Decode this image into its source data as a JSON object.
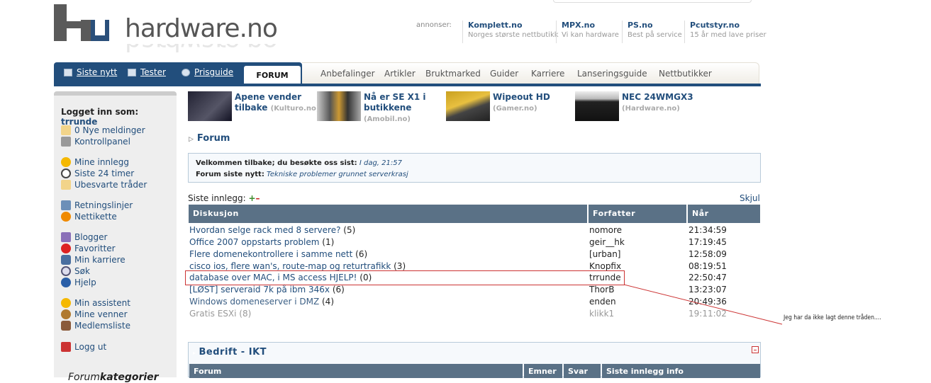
{
  "header": {
    "logo_text": "hardware.no",
    "ads_label": "annonser:",
    "ads": [
      {
        "title": "Komplett.no",
        "sub": "Norges største nettbutikk"
      },
      {
        "title": "MPX.no",
        "sub": "Vi kan hardware"
      },
      {
        "title": "PS.no",
        "sub": "Best på service"
      },
      {
        "title": "Pcutstyr.no",
        "sub": "15 år med lave priser"
      }
    ]
  },
  "nav": {
    "left_tabs": [
      "Siste nytt",
      "Tester",
      "Prisguide"
    ],
    "active_tab": "FORUM",
    "right_tabs": [
      "Anbefalinger",
      "Artikler",
      "Bruktmarked",
      "Guider",
      "Karriere",
      "Lanseringsguide",
      "Nettbutikker"
    ]
  },
  "sidebar": {
    "login_label": "Logget inn som:",
    "username": "trrunde",
    "group1": [
      "0 Nye meldinger",
      "Kontrollpanel"
    ],
    "group2": [
      "Mine innlegg",
      "Siste 24 timer",
      "Ubesvarte tråder"
    ],
    "group3": [
      "Retningslinjer",
      "Nettikette"
    ],
    "group4": [
      "Blogger",
      "Favoritter",
      "Min karriere",
      "Søk",
      "Hjelp"
    ],
    "group5": [
      "Min assistent",
      "Mine venner",
      "Medlemsliste"
    ],
    "group6": [
      "Logg ut"
    ],
    "forumkat_a": "Forum",
    "forumkat_b": "kategorier"
  },
  "news": [
    {
      "title": "Apene vender tilbake",
      "src": "(Kulturo.no)"
    },
    {
      "title": "Nå er SE X1 i butikkene",
      "src": "(Amobil.no)"
    },
    {
      "title": "Wipeout HD",
      "src": "(Gamer.no)"
    },
    {
      "title": "NEC 24WMGX3",
      "src": "(Hardware.no)"
    }
  ],
  "forum": {
    "heading": "Forum",
    "welcome_label": "Velkommen tilbake; du besøkte oss sist:",
    "welcome_value": "I dag, 21:57",
    "news_label": "Forum siste nytt:",
    "news_value": "Tekniske problemer grunnet serverkrasj",
    "recent_label": "Siste innlegg:",
    "hide_label": "Skjul"
  },
  "recent": {
    "columns": [
      "Diskusjon",
      "Forfatter",
      "Når"
    ],
    "rows": [
      {
        "title": "Hvordan selge rack med 8 servere?",
        "count": "(5)",
        "author": "nomore",
        "time": "21:34:59"
      },
      {
        "title": "Office 2007 oppstarts problem",
        "count": "(1)",
        "author": "geir__hk",
        "time": "17:19:45"
      },
      {
        "title": "Flere domenekontrollere i samme nett",
        "count": "(6)",
        "author": "[urban]",
        "time": "12:58:09"
      },
      {
        "title": "cisco ios, flere wan's, route-map og returtrafikk",
        "count": "(3)",
        "author": "Knopfix",
        "time": "08:19:51"
      },
      {
        "title": "database over MAC, i MS access HJELP!",
        "count": "(0)",
        "author": "trrunde",
        "time": "22:50:47"
      },
      {
        "title": "[LØST] serveraid 7k på ibm 346x",
        "count": "(6)",
        "author": "ThorB",
        "time": "13:23:07"
      },
      {
        "title": "Windows domeneserver i DMZ",
        "count": "(4)",
        "author": "enden",
        "time": "20:49:36"
      },
      {
        "title": "Gratis ESXi",
        "count": "(8)",
        "author": "klikk1",
        "time": "19:11:02"
      }
    ]
  },
  "annotation": "Jeg har da ikke lagt denne tråden....",
  "bedrift": {
    "title": "Bedrift - IKT",
    "columns": [
      "Forum",
      "Emner",
      "Svar",
      "Siste innlegg info"
    ]
  },
  "colors": {
    "brand": "#224e7c",
    "table_header": "#5a7186",
    "highlight": "#cc3333"
  }
}
